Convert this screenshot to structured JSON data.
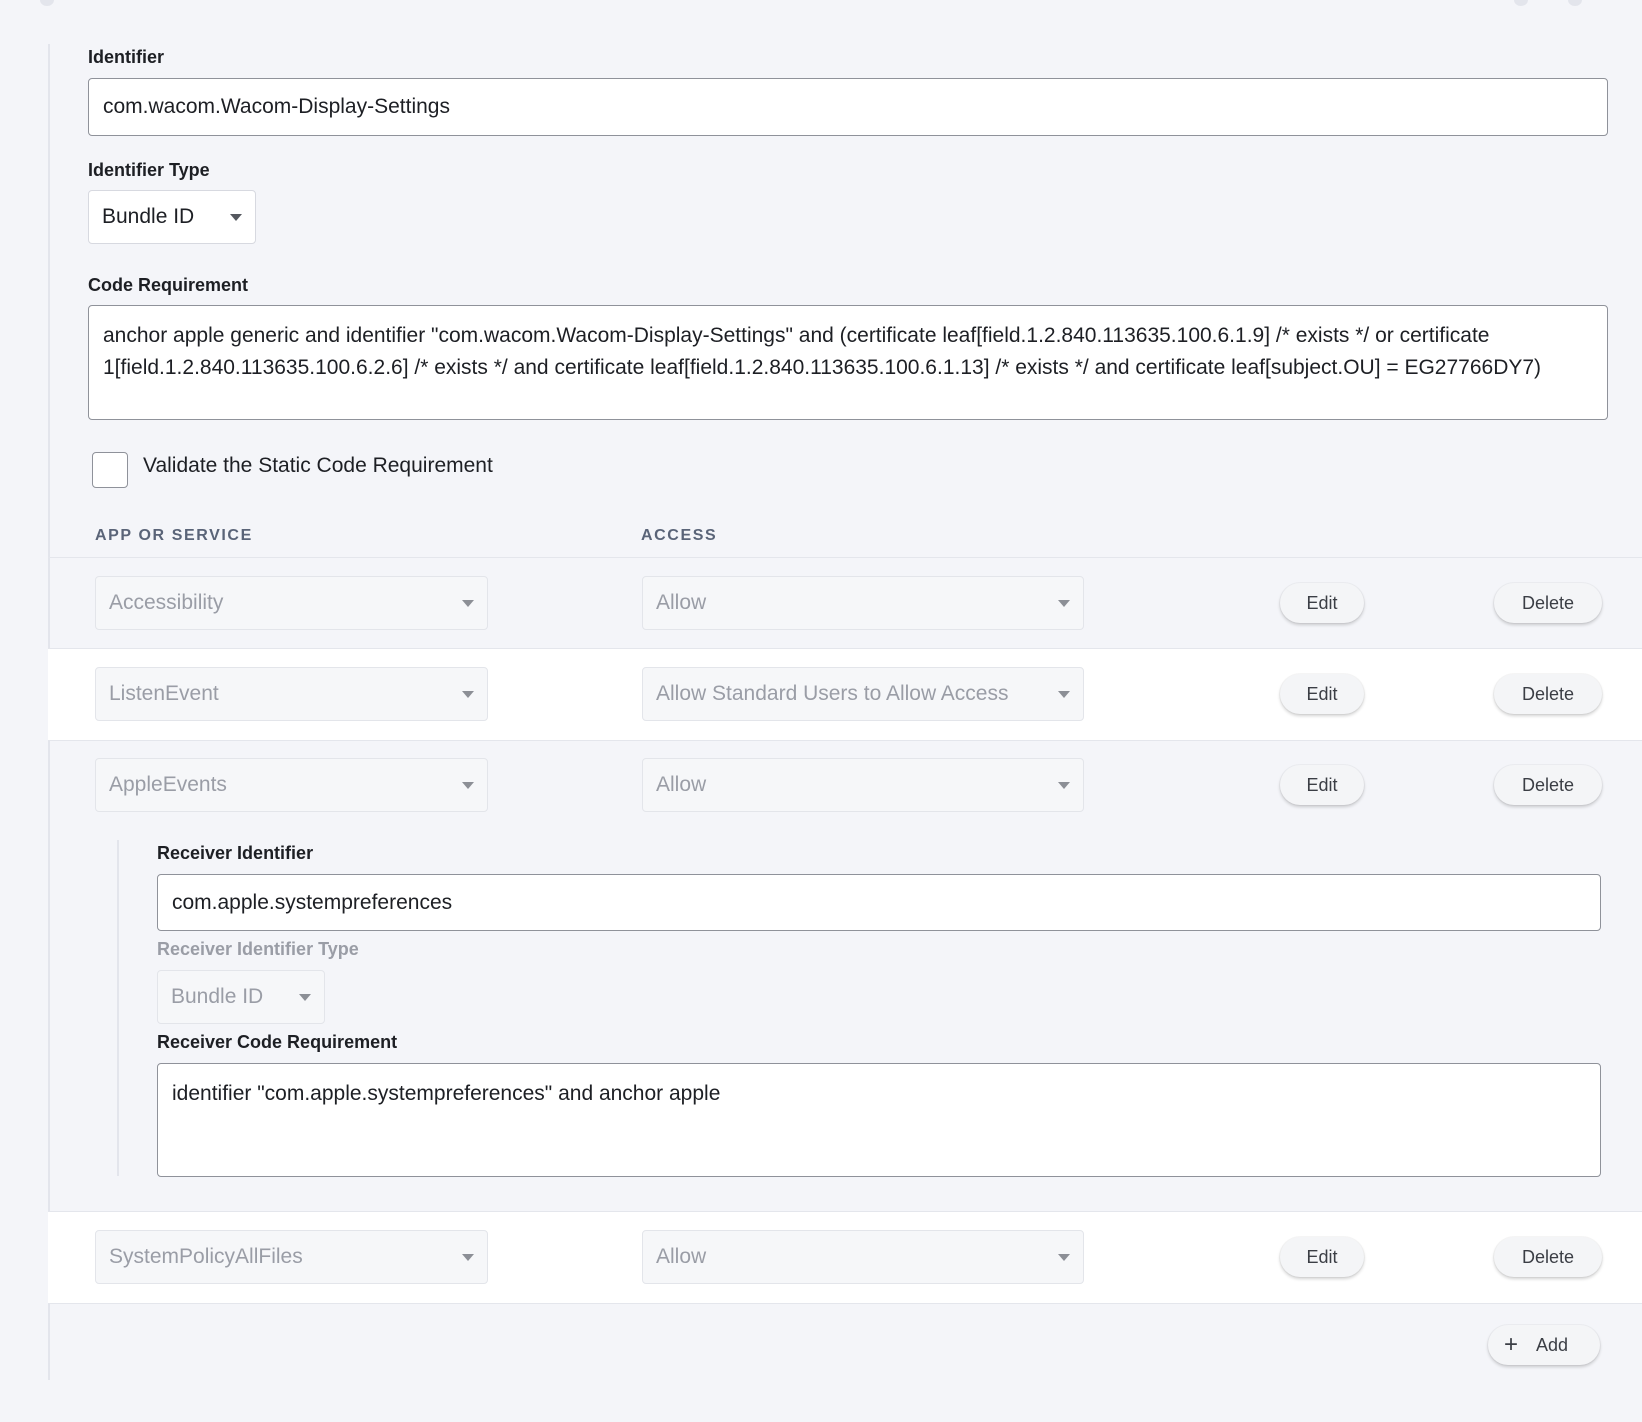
{
  "identifier": {
    "label": "Identifier",
    "value": "com.wacom.Wacom-Display-Settings"
  },
  "identifier_type": {
    "label": "Identifier Type",
    "value": "Bundle ID"
  },
  "code_requirement": {
    "label": "Code Requirement",
    "value": "anchor apple generic and identifier \"com.wacom.Wacom-Display-Settings\" and (certificate leaf[field.1.2.840.113635.100.6.1.9] /* exists */ or certificate 1[field.1.2.840.113635.100.6.2.6] /* exists */ and certificate leaf[field.1.2.840.113635.100.6.1.13] /* exists */ and certificate leaf[subject.OU] = EG27766DY7)"
  },
  "validate_checkbox": {
    "label": "Validate the Static Code Requirement",
    "checked": false
  },
  "table": {
    "headers": {
      "app_or_service": "APP OR SERVICE",
      "access": "ACCESS"
    },
    "edit_label": "Edit",
    "delete_label": "Delete",
    "rows": [
      {
        "service": "Accessibility",
        "access": "Allow"
      },
      {
        "service": "ListenEvent",
        "access": "Allow Standard Users to Allow Access"
      },
      {
        "service": "AppleEvents",
        "access": "Allow"
      },
      {
        "service": "SystemPolicyAllFiles",
        "access": "Allow"
      }
    ]
  },
  "apple_events_detail": {
    "receiver_identifier_label": "Receiver Identifier",
    "receiver_identifier_value": "com.apple.systempreferences",
    "receiver_identifier_type_label": "Receiver Identifier Type",
    "receiver_identifier_type_value": "Bundle ID",
    "receiver_code_requirement_label": "Receiver Code Requirement",
    "receiver_code_requirement_value": "identifier \"com.apple.systempreferences\" and anchor apple"
  },
  "add_button": {
    "icon": "plus-icon",
    "label": "Add"
  }
}
